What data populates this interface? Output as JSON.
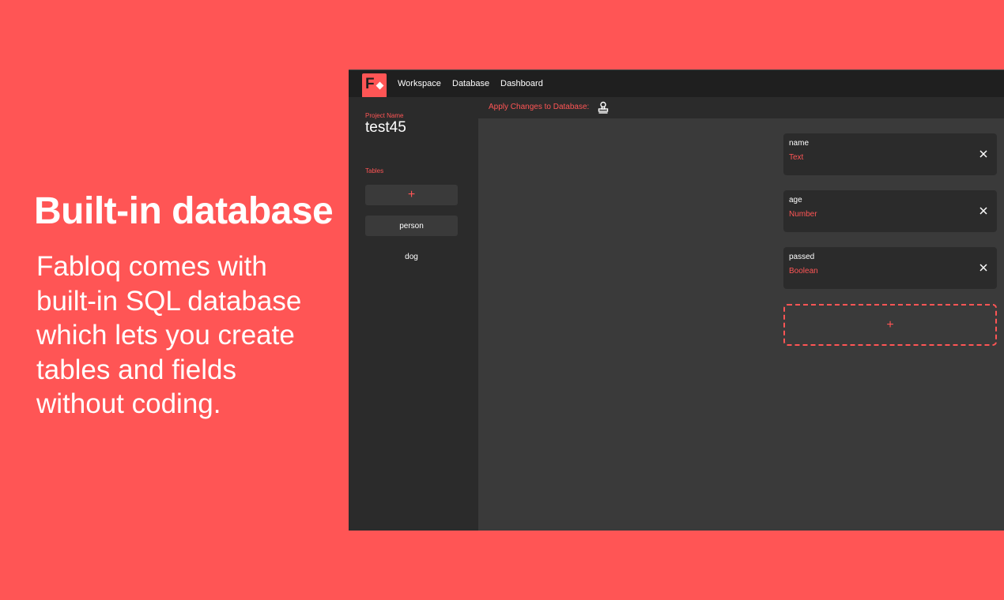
{
  "promo": {
    "title": "Built-in database",
    "body_lines": [
      "Fabloq comes with",
      "built-in SQL database",
      "which lets you create",
      "tables and fields",
      "without coding."
    ]
  },
  "app": {
    "logo_letter": "F",
    "nav": [
      "Workspace",
      "Database",
      "Dashboard"
    ],
    "sidebar": {
      "project_label": "Project Name",
      "project_name": "test45",
      "tables_label": "Tables",
      "add_table_glyph": "+",
      "tables": [
        "person",
        "dog"
      ]
    },
    "apply_bar": {
      "label": "Apply Changes to Database:",
      "icon": "stamp-icon"
    },
    "fields": [
      {
        "name": "name",
        "type": "Text"
      },
      {
        "name": "age",
        "type": "Number"
      },
      {
        "name": "passed",
        "type": "Boolean"
      }
    ],
    "add_field_glyph": "+",
    "colors": {
      "accent": "#ff5555",
      "topbar": "#1f1f1f",
      "panel": "#2b2b2b",
      "canvas": "#3a3a3a"
    }
  }
}
